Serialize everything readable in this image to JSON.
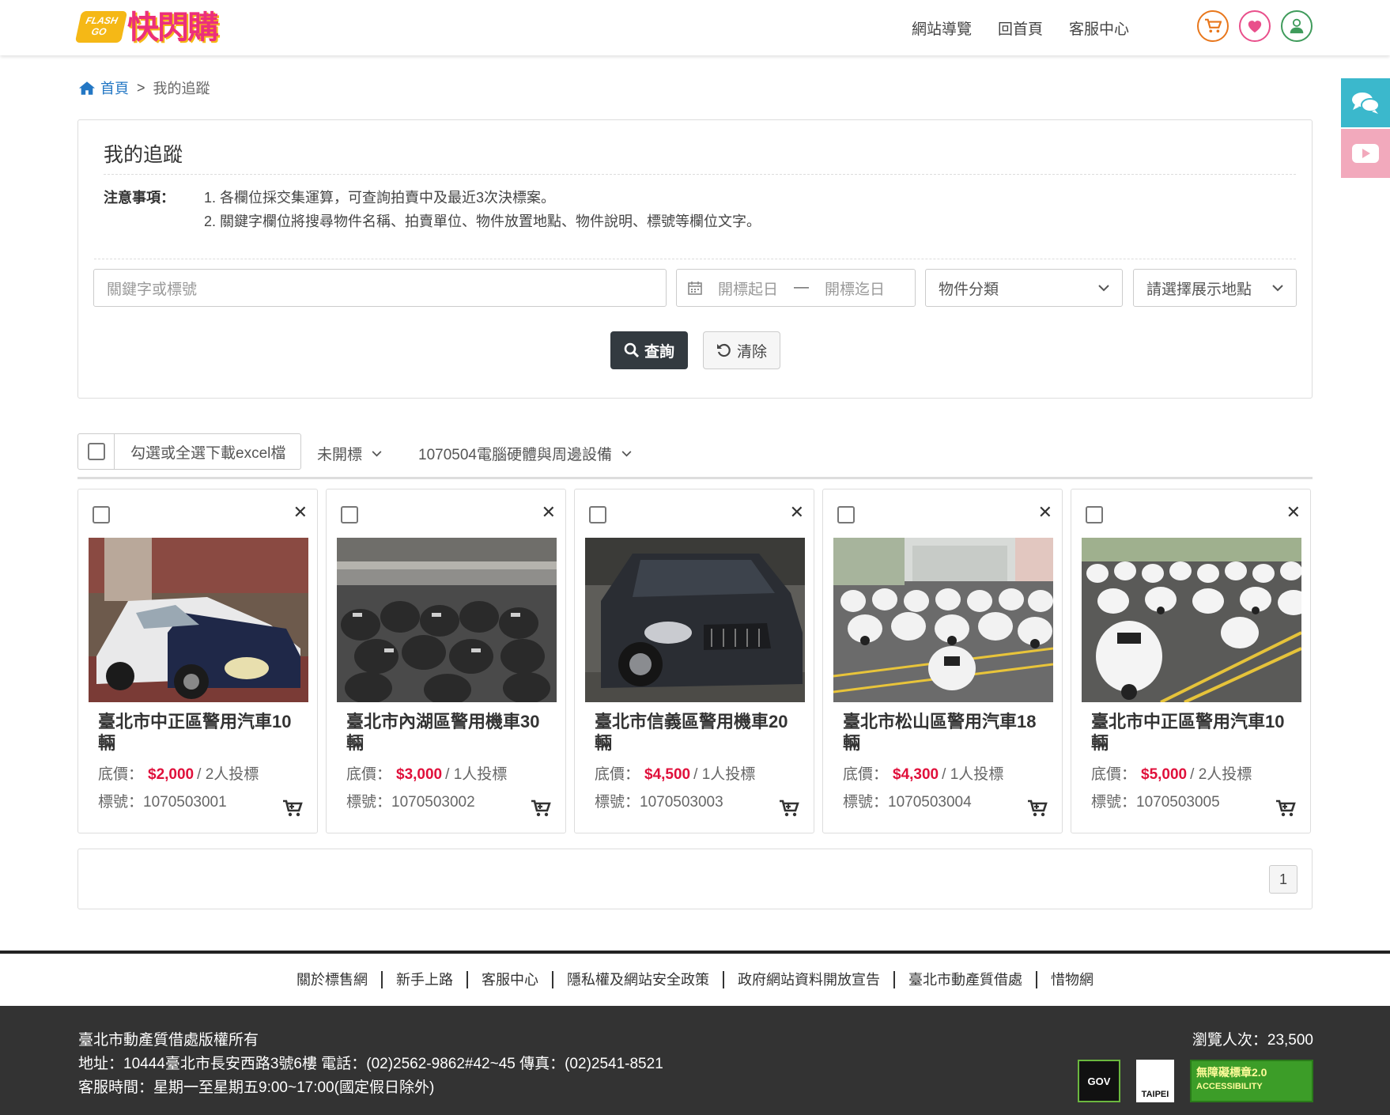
{
  "header": {
    "logo_flash": "FLASH",
    "logo_go": "GO",
    "logo_text": "快閃購",
    "nav": [
      "網站導覽",
      "回首頁",
      "客服中心"
    ]
  },
  "breadcrumb": {
    "home": "首頁",
    "sep": ">",
    "current": "我的追蹤"
  },
  "panel": {
    "title": "我的追蹤",
    "notice_label": "注意事項：",
    "notices": [
      "1. 各欄位採交集運算，可查詢拍賣中及最近3次決標案。",
      "2. 關鍵字欄位將搜尋物件名稱、拍賣單位、物件放置地點、物件說明、標號等欄位文字。"
    ],
    "keyword_placeholder": "關鍵字或標號",
    "date_start": "開標起日",
    "date_dash": "—",
    "date_end": "開標迄日",
    "category": "物件分類",
    "location": "請選擇展示地點",
    "search_btn": "查詢",
    "clear_btn": "清除"
  },
  "toolbar": {
    "select_all": "勾選或全選下載excel檔",
    "status": "未開標",
    "batch": "1070504電腦硬體與周邊設備"
  },
  "cards": [
    {
      "title": "臺北市中正區警用汽車10輛",
      "price_label": "底價：",
      "price": "$2,000",
      "bids": "/ 2人投標",
      "id": "標號：1070503001",
      "photo": "car-white-blue"
    },
    {
      "title": "臺北市內湖區警用機車30輛",
      "price_label": "底價：",
      "price": "$3,000",
      "bids": "/ 1人投標",
      "id": "標號：1070503002",
      "photo": "scooters-garage"
    },
    {
      "title": "臺北市信義區警用機車20輛",
      "price_label": "底價：",
      "price": "$4,500",
      "bids": "/ 1人投標",
      "id": "標號：1070503003",
      "photo": "car-black"
    },
    {
      "title": "臺北市松山區警用汽車18輛",
      "price_label": "底價：",
      "price": "$4,300",
      "bids": "/ 1人投標",
      "id": "標號：1070503004",
      "photo": "scooters-street"
    },
    {
      "title": "臺北市中正區警用汽車10輛",
      "price_label": "底價：",
      "price": "$5,000",
      "bids": "/ 2人投標",
      "id": "標號：1070503005",
      "photo": "scooters-white"
    }
  ],
  "pager": {
    "page": "1"
  },
  "footer_links": [
    "關於標售網",
    "新手上路",
    "客服中心",
    "隱私權及網站安全政策",
    "政府網站資料開放宣告",
    "臺北市動產質借處",
    "惜物網"
  ],
  "footer": {
    "copyright": "臺北市動產質借處版權所有",
    "address": "地址：10444臺北市長安西路3號6樓 電話：(02)2562-9862#42~45 傳真：(02)2541-8521",
    "hours": "客服時間：星期一至星期五9:00~17:00(國定假日除外)",
    "visits": "瀏覽人次：23,500",
    "badge_gov": "GOV",
    "badge_taipei": "TAIPEI",
    "badge_access": "無障礙標章2.0",
    "badge_access_sub": "ACCESSIBILITY"
  },
  "colors": {
    "accent_red": "#e0103b",
    "link_blue": "#2377c4",
    "dark_button": "#333a40",
    "footer_bg": "#333333"
  }
}
